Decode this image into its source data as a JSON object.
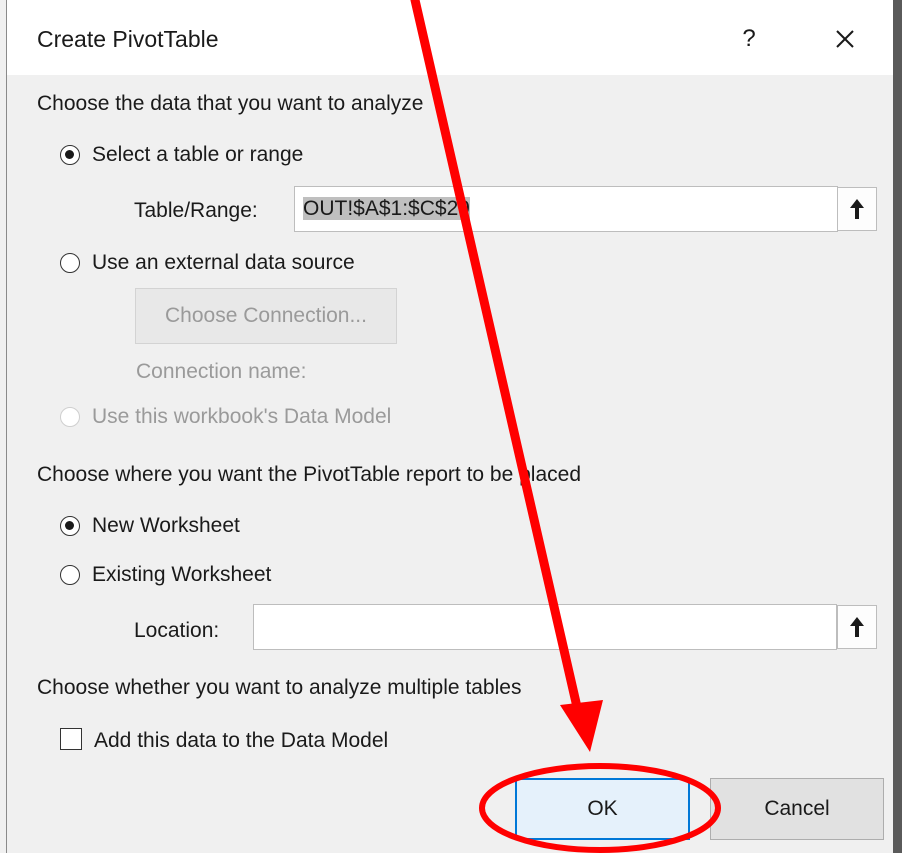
{
  "dialog": {
    "title": "Create PivotTable",
    "help_label": "?",
    "section_data": "Choose the data that you want to analyze",
    "select_range_label": "Select a table or range",
    "table_range_label": "Table/Range:",
    "table_range_value": "OUT!$A$1:$C$29",
    "external_source_label": "Use an external data source",
    "choose_connection_label": "Choose Connection...",
    "connection_name_label": "Connection name:",
    "data_model_option_label": "Use this workbook's Data Model",
    "section_place": "Choose where you want the PivotTable report to be placed",
    "new_worksheet_label": "New Worksheet",
    "existing_worksheet_label": "Existing Worksheet",
    "location_label": "Location:",
    "location_value": "",
    "section_multiple": "Choose whether you want to analyze multiple tables",
    "add_data_model_label": "Add this data to the Data Model",
    "ok_label": "OK",
    "cancel_label": "Cancel"
  },
  "state": {
    "source_choice": "Select a table or range",
    "placement_choice": "New Worksheet",
    "add_to_data_model": false
  },
  "icons": [
    "close-icon",
    "collapse-dialog-icon"
  ],
  "annotation": {
    "color": "#ff0000"
  }
}
